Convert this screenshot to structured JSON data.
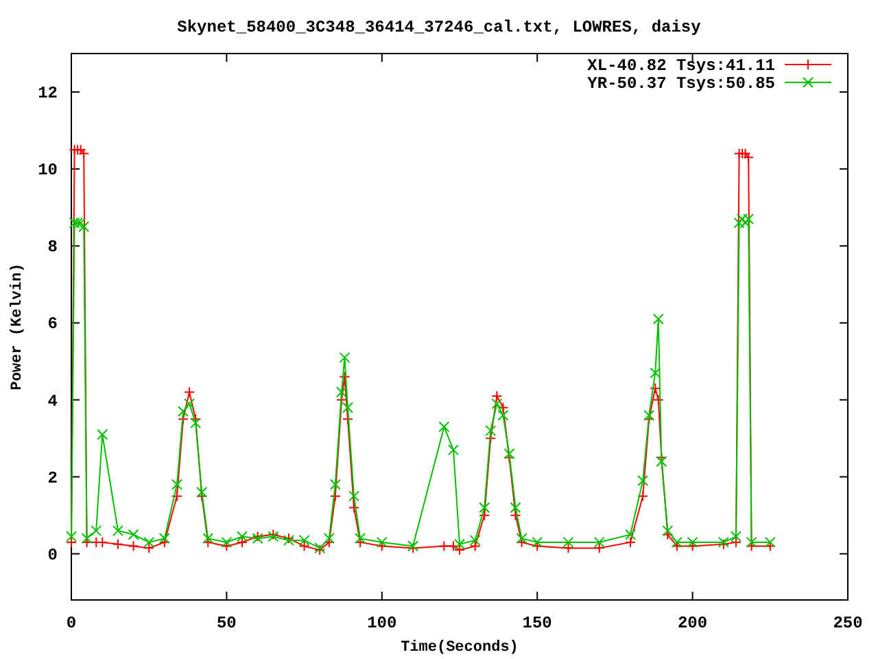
{
  "chart_data": {
    "type": "line",
    "title": "Skynet_58400_3C348_36414_37246_cal.txt, LOWRES, daisy",
    "xlabel": "Time(Seconds)",
    "ylabel": "Power (Kelvin)",
    "x": [
      0,
      1,
      2,
      3,
      4,
      5,
      8,
      10,
      15,
      20,
      25,
      30,
      34,
      36,
      38,
      40,
      42,
      44,
      50,
      55,
      60,
      65,
      70,
      75,
      80,
      83,
      85,
      87,
      88,
      89,
      91,
      93,
      100,
      110,
      120,
      123,
      125,
      130,
      133,
      135,
      137,
      139,
      141,
      143,
      145,
      150,
      160,
      170,
      180,
      184,
      186,
      188,
      189,
      190,
      192,
      195,
      200,
      210,
      214,
      215,
      216,
      217,
      218,
      219,
      225
    ],
    "series": [
      {
        "name": "XL-40.82 Tsys:41.11",
        "color": "#ff0000",
        "marker": "plus",
        "values": [
          0.3,
          10.5,
          10.5,
          10.5,
          10.4,
          0.3,
          0.3,
          0.3,
          0.25,
          0.2,
          0.15,
          0.3,
          1.5,
          3.5,
          4.2,
          3.5,
          1.5,
          0.3,
          0.2,
          0.3,
          0.45,
          0.5,
          0.4,
          0.2,
          0.1,
          0.3,
          1.5,
          4,
          4.6,
          3.5,
          1.2,
          0.3,
          0.2,
          0.15,
          0.2,
          0.2,
          0.1,
          0.2,
          1,
          3,
          4.1,
          3.8,
          2.5,
          1,
          0.3,
          0.2,
          0.15,
          0.15,
          0.3,
          1.5,
          3.5,
          4.3,
          4,
          2.5,
          0.5,
          0.2,
          0.2,
          0.25,
          0.3,
          10.4,
          10.4,
          10.4,
          10.3,
          0.2,
          0.2
        ]
      },
      {
        "name": "YR-50.37 Tsys:50.85",
        "color": "#00c000",
        "marker": "x",
        "values": [
          0.45,
          8.6,
          8.6,
          8.6,
          8.5,
          0.4,
          0.6,
          3.1,
          0.6,
          0.5,
          0.3,
          0.4,
          1.8,
          3.7,
          3.9,
          3.4,
          1.6,
          0.4,
          0.3,
          0.45,
          0.4,
          0.45,
          0.35,
          0.35,
          0.15,
          0.4,
          1.8,
          4.2,
          5.1,
          3.8,
          1.5,
          0.4,
          0.3,
          0.2,
          3.3,
          2.7,
          0.25,
          0.35,
          1.2,
          3.2,
          3.9,
          3.6,
          2.6,
          1.2,
          0.4,
          0.3,
          0.3,
          0.3,
          0.5,
          1.9,
          3.6,
          4.7,
          6.1,
          2.4,
          0.6,
          0.3,
          0.3,
          0.3,
          0.45,
          8.6,
          8.7,
          8.6,
          8.7,
          0.3,
          0.3
        ]
      }
    ],
    "legend": true,
    "xlim": [
      0,
      250
    ],
    "ylim": [
      -1.2,
      13
    ],
    "xticks": [
      0,
      50,
      100,
      150,
      200,
      250
    ],
    "yticks": [
      0,
      2,
      4,
      6,
      8,
      10,
      12
    ]
  }
}
